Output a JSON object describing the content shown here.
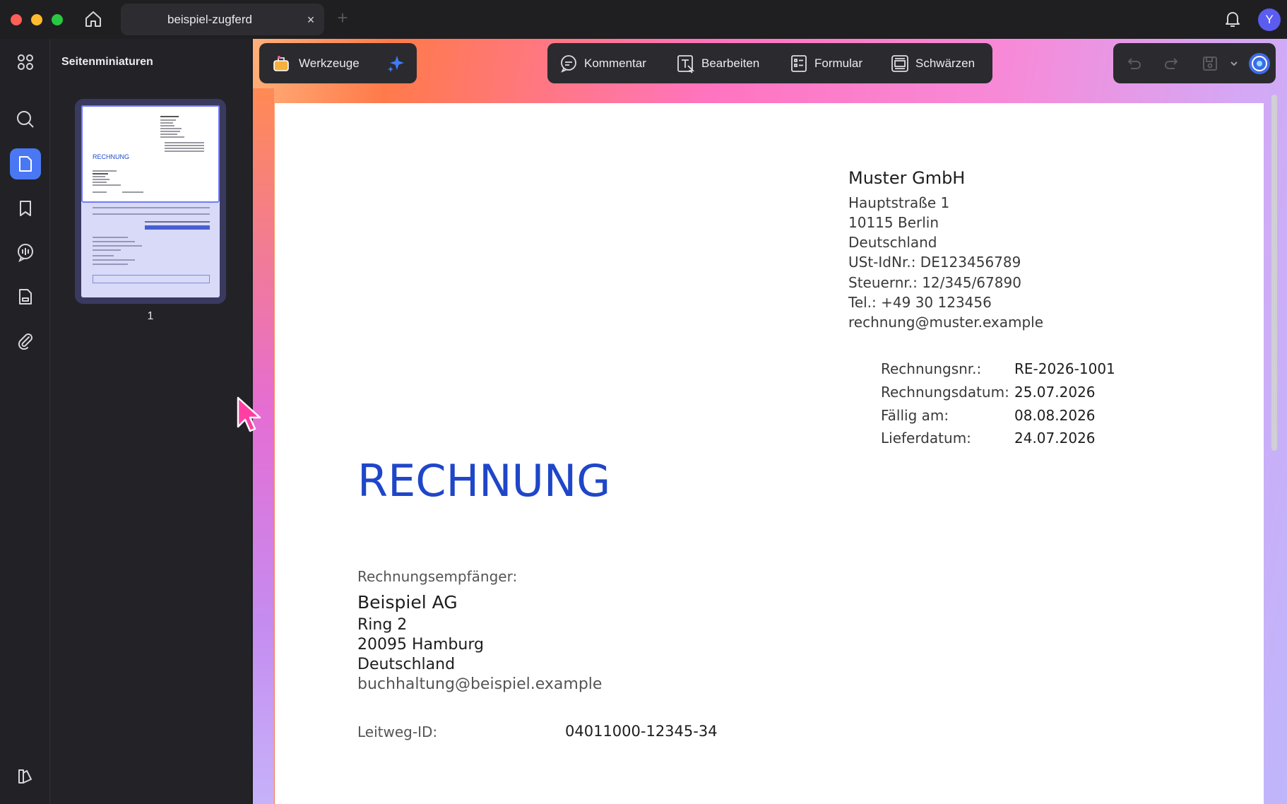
{
  "window": {
    "tab_title": "beispiel-zugferd",
    "tab_close": "×",
    "tab_add": "+",
    "avatar_initial": "Y"
  },
  "thumbnails": {
    "title": "Seitenminiaturen",
    "page_number": "1",
    "preview_heading": "RECHNUNG"
  },
  "toolbar": {
    "tools_label": "Werkzeuge",
    "comment_label": "Kommentar",
    "edit_label": "Bearbeiten",
    "form_label": "Formular",
    "redact_label": "Schwärzen"
  },
  "document": {
    "sender": {
      "name": "Muster GmbH",
      "lines": [
        "Hauptstraße 1",
        "10115 Berlin",
        "Deutschland",
        "USt-IdNr.: DE123456789",
        "Steuernr.: 12/345/67890",
        "Tel.: +49 30 123456",
        "rechnung@muster.example"
      ]
    },
    "meta": [
      {
        "label": "Rechnungsnr.:",
        "value": "RE-2026-1001"
      },
      {
        "label": "Rechnungsdatum:",
        "value": "25.07.2026"
      },
      {
        "label": "Fällig am:",
        "value": "08.08.2026"
      },
      {
        "label": "Lieferdatum:",
        "value": "24.07.2026"
      }
    ],
    "title": "RECHNUNG",
    "recipient": {
      "label": "Rechnungsempfänger:",
      "name": "Beispiel AG",
      "lines": [
        "Ring 2",
        "20095 Hamburg",
        "Deutschland"
      ],
      "email": "buchhaltung@beispiel.example"
    },
    "leitweg": {
      "label": "Leitweg-ID:",
      "value": "04011000-12345-34"
    }
  },
  "colors": {
    "accent": "#4a78f4",
    "invoice_title": "#1f46c9",
    "cursor": "#ff3fa4"
  }
}
